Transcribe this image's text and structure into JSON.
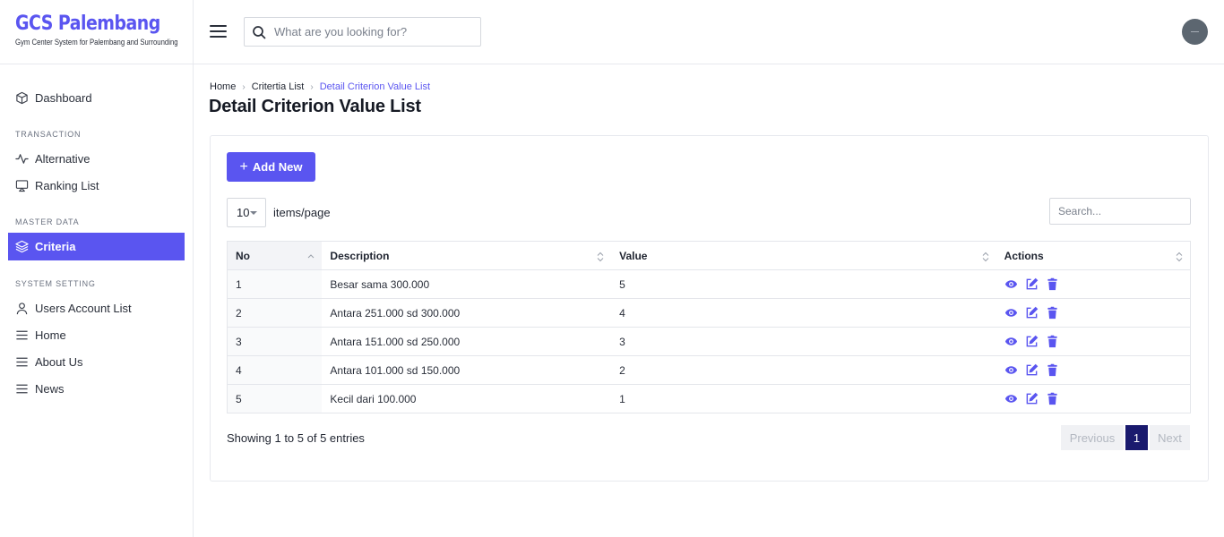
{
  "brand": {
    "title": "GCS Palembang",
    "subtitle": "Gym Center System for Palembang and Surrounding"
  },
  "topbar": {
    "search_placeholder": "What are you looking for?"
  },
  "sidebar": {
    "dashboard": "Dashboard",
    "sections": {
      "transaction": "TRANSACTION",
      "master_data": "MASTER DATA",
      "system_setting": "SYSTEM SETTING"
    },
    "items": {
      "alternative": "Alternative",
      "ranking_list": "Ranking List",
      "criteria": "Criteria",
      "users_account_list": "Users Account List",
      "home": "Home",
      "about_us": "About Us",
      "news": "News"
    }
  },
  "breadcrumb": {
    "home": "Home",
    "criteria_list": "Critertia List",
    "current": "Detail Criterion Value List"
  },
  "page": {
    "title": "Detail Criterion Value List"
  },
  "toolbar": {
    "add_label": "Add New",
    "per_page_value": "10",
    "per_page_label": "items/page",
    "search_placeholder": "Search..."
  },
  "table": {
    "headers": {
      "no": "No",
      "description": "Description",
      "value": "Value",
      "actions": "Actions"
    },
    "rows": [
      {
        "no": "1",
        "description": "Besar sama 300.000",
        "value": "5"
      },
      {
        "no": "2",
        "description": "Antara 251.000 sd 300.000",
        "value": "4"
      },
      {
        "no": "3",
        "description": "Antara 151.000 sd 250.000",
        "value": "3"
      },
      {
        "no": "4",
        "description": "Antara 101.000 sd 150.000",
        "value": "2"
      },
      {
        "no": "5",
        "description": "Kecil dari 100.000",
        "value": "1"
      }
    ]
  },
  "footer": {
    "showing": "Showing 1 to 5 of 5 entries",
    "previous": "Previous",
    "page": "1",
    "next": "Next"
  },
  "colors": {
    "accent": "#5a55f0",
    "pager_active": "#1a1a6e"
  }
}
